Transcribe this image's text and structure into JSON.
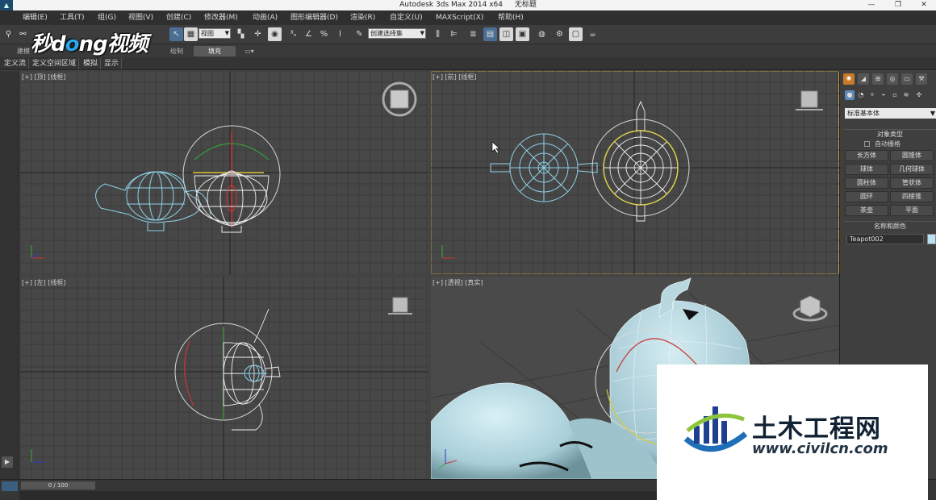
{
  "window": {
    "app_title": "Autodesk 3ds Max  2014 x64",
    "doc_title": "无标题",
    "minimize": "—",
    "restore": "❐",
    "close": "✕"
  },
  "menu": [
    {
      "id": "edit",
      "label": "编辑(E)"
    },
    {
      "id": "tools",
      "label": "工具(T)"
    },
    {
      "id": "group",
      "label": "组(G)"
    },
    {
      "id": "views",
      "label": "视图(V)"
    },
    {
      "id": "create",
      "label": "创建(C)"
    },
    {
      "id": "modifiers",
      "label": "修改器(M)"
    },
    {
      "id": "animation",
      "label": "动画(A)"
    },
    {
      "id": "graph-editors",
      "label": "图形编辑器(D)"
    },
    {
      "id": "rendering",
      "label": "渲染(R)"
    },
    {
      "id": "customize",
      "label": "自定义(U)"
    },
    {
      "id": "maxscript",
      "label": "MAXScript(X)"
    },
    {
      "id": "help",
      "label": "帮助(H)"
    }
  ],
  "toolbar": {
    "view_dropdown": "视图",
    "selection_set": "创建选择集"
  },
  "ribbon": {
    "tab_modeling": "建模",
    "tab_draw": "绘制",
    "tab_fill": "填充"
  },
  "subtabs": [
    "定义流",
    "定义空间区域",
    "模拟",
    "显示"
  ],
  "brand_top": {
    "part1": "秒d",
    "o": "o",
    "part2": "ng视频"
  },
  "viewports": {
    "top": "[+] [顶] [线框]",
    "front": "[+] [前] [线框]",
    "left": "[+] [左] [线框]",
    "persp": "[+] [透视] [真实]"
  },
  "command_panel": {
    "dropdown": "标准基本体",
    "object_type_title": "对象类型",
    "autogrid": "自动栅格",
    "buttons": [
      "长方体",
      "圆锥体",
      "球体",
      "几何球体",
      "圆柱体",
      "管状体",
      "圆环",
      "四棱锥",
      "茶壶",
      "平面"
    ],
    "name_color_title": "名称和颜色",
    "object_name": "Teapot002",
    "object_color": "#b8e2f0"
  },
  "timeline": {
    "frame": "0 / 100"
  },
  "brand_bottom": {
    "name": "土木工程网",
    "url": "www.civilcn.com"
  }
}
